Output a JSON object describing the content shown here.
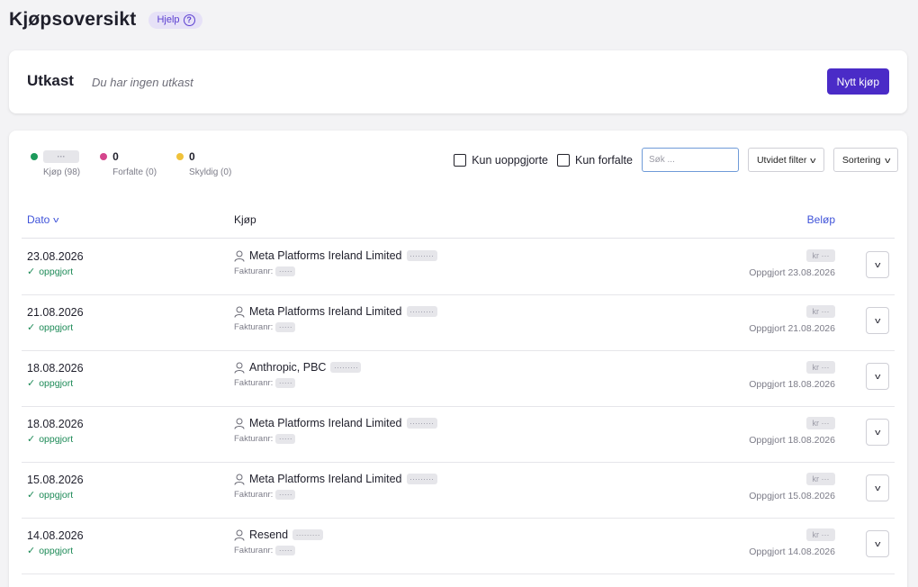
{
  "header": {
    "title": "Kjøpsoversikt",
    "help_label": "Hjelp",
    "help_icon_glyph": "?"
  },
  "drafts": {
    "title": "Utkast",
    "empty_text": "Du har ingen utkast",
    "new_button_label": "Nytt kjøp"
  },
  "summary": [
    {
      "count": "···",
      "label": "Kjøp (98)",
      "color": "#1d9a5b",
      "masked": true
    },
    {
      "count": "0",
      "label": "Forfalte (0)",
      "color": "#d4458c",
      "masked": false
    },
    {
      "count": "0",
      "label": "Skyldig (0)",
      "color": "#f0c23a",
      "masked": false
    }
  ],
  "filters": {
    "unsettled_label": "Kun uoppgjorte",
    "overdue_label": "Kun forfalte",
    "search_placeholder": "Søk ...",
    "extended_filter_label": "Utvidet filter",
    "sort_label": "Sortering",
    "chevron_glyph": "v"
  },
  "table": {
    "col_date": "Dato",
    "col_purchase": "Kjøp",
    "col_amount": "Beløp",
    "invoice_prefix": "Fakturanr:",
    "mask_short": "·····",
    "mask_long": "·········",
    "amount_mask": "kr ···",
    "status_glyph": "✓",
    "expand_glyph": "v",
    "rows": [
      {
        "date": "23.08.2026",
        "status": "oppgjort",
        "party": "Meta Platforms Ireland Limited",
        "settled": "Oppgjort 23.08.2026"
      },
      {
        "date": "21.08.2026",
        "status": "oppgjort",
        "party": "Meta Platforms Ireland Limited",
        "settled": "Oppgjort 21.08.2026"
      },
      {
        "date": "18.08.2026",
        "status": "oppgjort",
        "party": "Anthropic, PBC",
        "settled": "Oppgjort 18.08.2026"
      },
      {
        "date": "18.08.2026",
        "status": "oppgjort",
        "party": "Meta Platforms Ireland Limited",
        "settled": "Oppgjort 18.08.2026"
      },
      {
        "date": "15.08.2026",
        "status": "oppgjort",
        "party": "Meta Platforms Ireland Limited",
        "settled": "Oppgjort 15.08.2026"
      },
      {
        "date": "14.08.2026",
        "status": "oppgjort",
        "party": "Resend",
        "settled": "Oppgjort 14.08.2026"
      }
    ]
  },
  "colors": {
    "accent": "#4a2bc7",
    "link": "#3f53d9",
    "settled_green": "#1d8a57"
  }
}
